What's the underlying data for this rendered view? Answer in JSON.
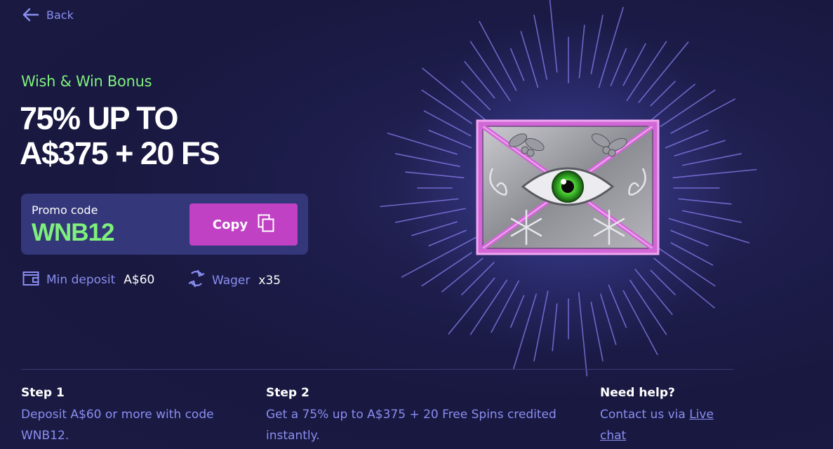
{
  "nav": {
    "back_label": "Back"
  },
  "bonus": {
    "name": "Wish & Win Bonus",
    "headline_line1": "75% UP TO",
    "headline_line2": "A$375 + 20 FS"
  },
  "promo": {
    "label": "Promo code",
    "code": "WNB12",
    "copy_label": "Copy"
  },
  "terms": {
    "min_deposit_label": "Min deposit",
    "min_deposit_value": "A$60",
    "wager_label": "Wager",
    "wager_value": "x35"
  },
  "steps": [
    {
      "title": "Step 1",
      "text": "Deposit A$60 or more with code WNB12."
    },
    {
      "title": "Step 2",
      "text": "Get a 75% up to A$375 + 20 Free Spins credited instantly."
    }
  ],
  "help": {
    "title": "Need help?",
    "text": "Contact us via",
    "link_label": "Live chat"
  },
  "colors": {
    "background": "#1c1c47",
    "accent_green": "#7ef07b",
    "accent_purple": "#c141c4",
    "link_blue": "#8a8ef0",
    "promo_box": "#34377a"
  },
  "icons": [
    "arrow-left-icon",
    "copy-icon",
    "wallet-icon",
    "refresh-icon",
    "eye-envelope-symbol"
  ]
}
